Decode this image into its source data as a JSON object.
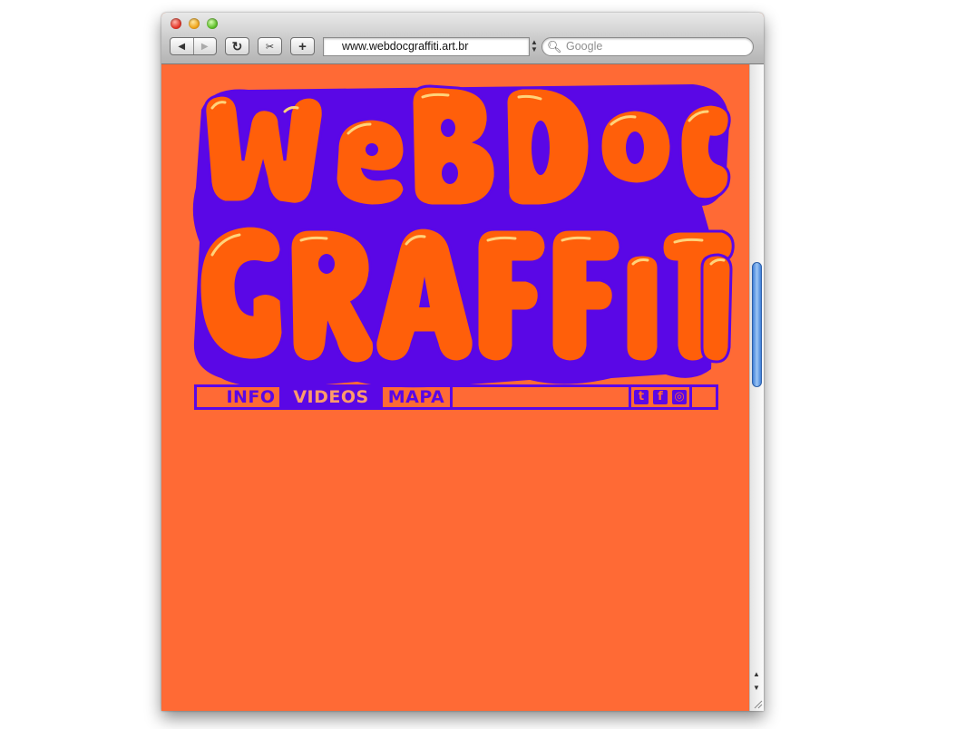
{
  "browser": {
    "url": "www.webdocgraffiti.art.br",
    "search_placeholder": "Google",
    "back_icon": "back-arrow-icon",
    "forward_icon": "forward-arrow-icon",
    "reload_icon": "reload-icon",
    "snippet_icon": "webclip-icon",
    "add_bookmark_label": "+"
  },
  "site": {
    "logo_lines": [
      "WEBDOC",
      "GRAFFITI"
    ],
    "colors": {
      "background": "#ff6a35",
      "purple": "#5a07e6",
      "letter": "#ff5f0a"
    },
    "nav": [
      {
        "label": "INFO"
      },
      {
        "label": "VIDEOS"
      },
      {
        "label": "MAPA"
      }
    ],
    "social": [
      {
        "icon": "twitter-icon",
        "glyph": "t"
      },
      {
        "icon": "facebook-icon",
        "glyph": "f"
      },
      {
        "icon": "instagram-icon",
        "glyph": "◎"
      }
    ]
  }
}
